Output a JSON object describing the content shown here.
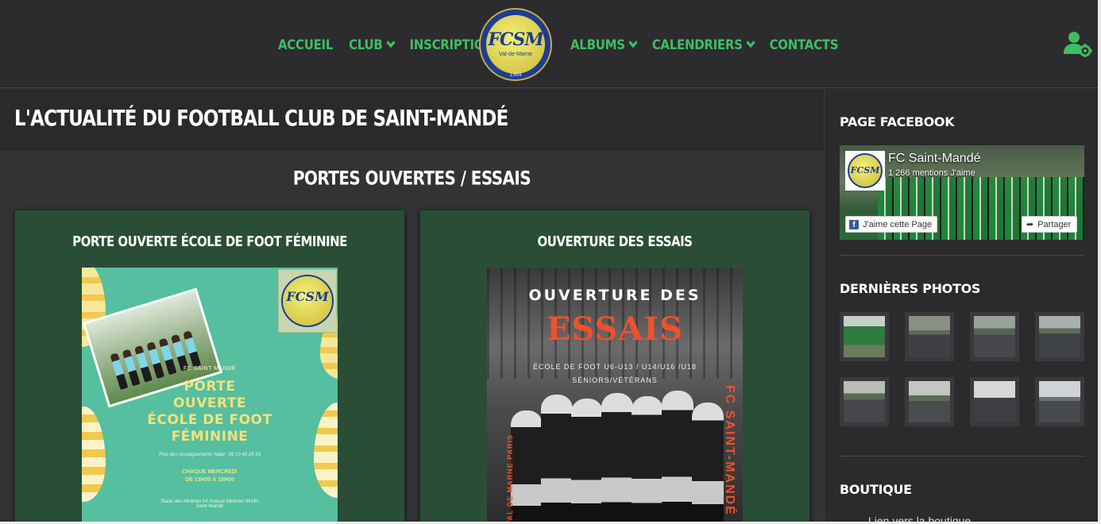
{
  "header": {
    "nav_left": [
      {
        "label": "ACCUEIL",
        "dropdown": false
      },
      {
        "label": "CLUB",
        "dropdown": true
      },
      {
        "label": "INSCRIPTIONS",
        "dropdown": false
      }
    ],
    "nav_right": [
      {
        "label": "ALBUMS",
        "dropdown": true
      },
      {
        "label": "CALENDRIERS",
        "dropdown": true
      },
      {
        "label": "CONTACTS",
        "dropdown": false
      }
    ],
    "logo": {
      "text": "FCSM",
      "subtitle": "Val-de-Marne",
      "year": "1964"
    },
    "user_icon": "user-gear-icon",
    "accent_color": "#3fbd64"
  },
  "main": {
    "page_title": "L'ACTUALITÉ DU FOOTBALL CLUB DE SAINT-MANDÉ",
    "section_title": "PORTES OUVERTES / ESSAIS",
    "cards": [
      {
        "title": "PORTE OUVERTE ÉCOLE DE FOOT FÉMININE",
        "poster": {
          "logo_text": "FCSM",
          "club": "FC SAINT MANDÉ",
          "headline": [
            "PORTE",
            "OUVERTE",
            "ÉCOLE DE FOOT",
            "FÉMININE"
          ],
          "info": "Plus des renseignements Nabil : 06 10 40 29 53",
          "day": [
            "CHAQUE MERCREDI",
            "DE 13H00 À 15H00"
          ],
          "address": [
            "Stade des Minimes 54 Avenue Minimes 94160",
            "Saint-Mandé"
          ]
        }
      },
      {
        "title": "OUVERTURE DES ESSAIS",
        "poster": {
          "line1": "OUVERTURE DES",
          "line2": "ESSAIS",
          "line3": "ÉCOLE DE FOOT U6-U13 / U14/U16 /U18",
          "line4": "SÉNIORS/VÉTÉRANS",
          "side": "FC SAINT-MANDÉ",
          "side_left": "VAL DE MARNE PARIS"
        }
      }
    ]
  },
  "sidebar": {
    "facebook_title": "PAGE FACEBOOK",
    "facebook": {
      "page_name": "FC Saint-Mandé",
      "likes": "1 266 mentions J'aime",
      "like_button": "J'aime cette Page",
      "share_button": "Partager"
    },
    "photos_title": "DERNIÈRES PHOTOS",
    "photos": [
      "team-photo",
      "field-photo",
      "field-photo",
      "field-photo",
      "field-photo",
      "field-photo",
      "field-photo",
      "field-photo"
    ],
    "shop_title": "BOUTIQUE",
    "shop_text": "Lien vers la boutique"
  }
}
